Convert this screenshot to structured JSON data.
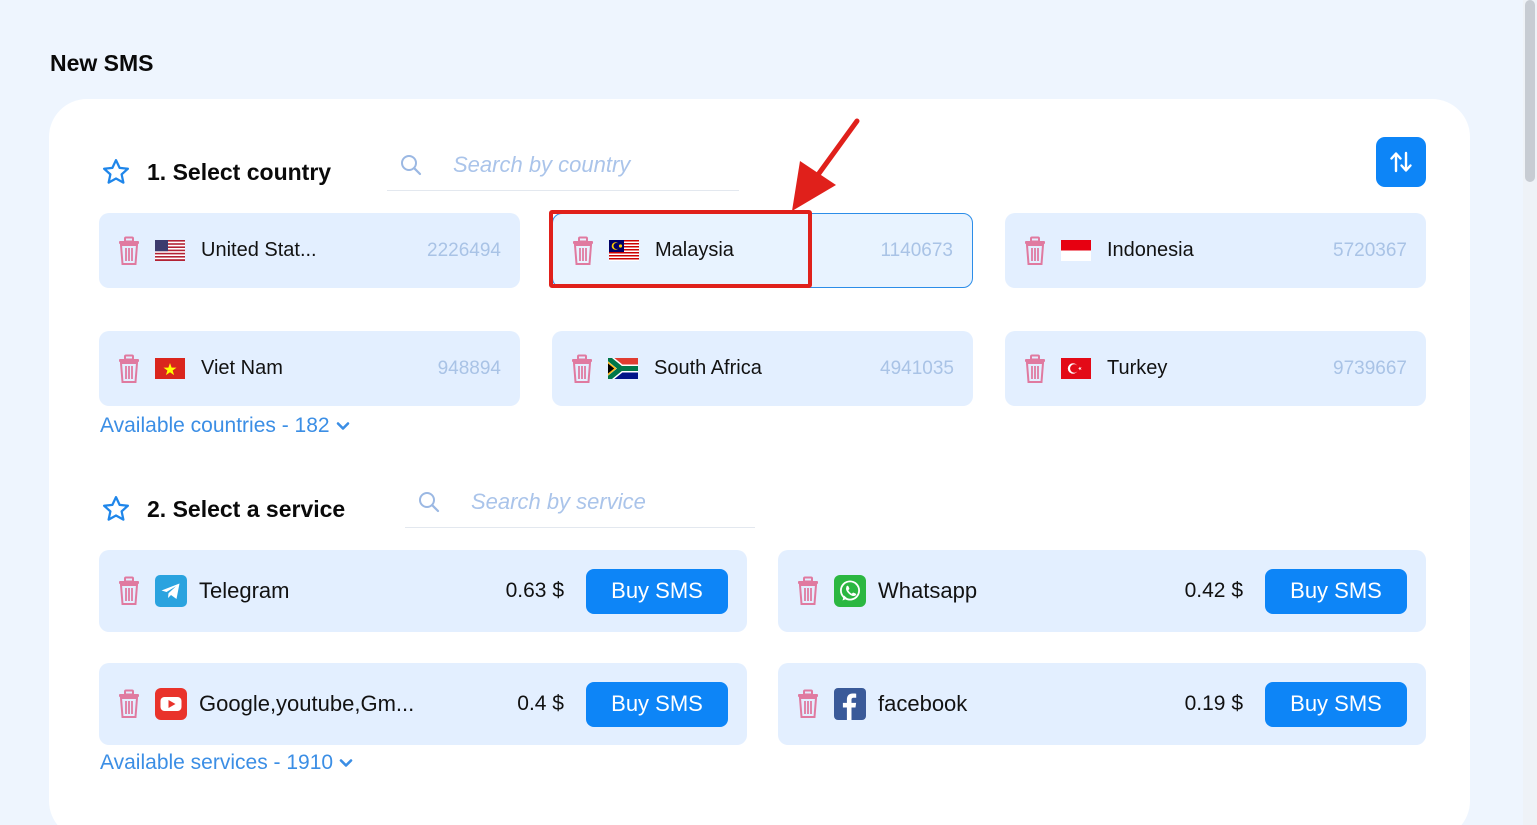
{
  "page_title": "New SMS",
  "country_section": {
    "title": "1. Select country",
    "search_placeholder": "Search by country",
    "countries": [
      {
        "name": "United Stat...",
        "count": "2226494",
        "flag": "us-flag",
        "selected": false
      },
      {
        "name": "Malaysia",
        "count": "1140673",
        "flag": "malaysia-flag",
        "selected": true
      },
      {
        "name": "Indonesia",
        "count": "5720367",
        "flag": "indonesia-flag",
        "selected": false
      },
      {
        "name": "Viet Nam",
        "count": "948894",
        "flag": "vietnam-flag",
        "selected": false
      },
      {
        "name": "South Africa",
        "count": "4941035",
        "flag": "south-africa-flag",
        "selected": false
      },
      {
        "name": "Turkey",
        "count": "9739667",
        "flag": "turkey-flag",
        "selected": false
      }
    ],
    "more_link": "Available countries - 182"
  },
  "service_section": {
    "title": "2. Select a service",
    "search_placeholder": "Search by service",
    "services": [
      {
        "name": "Telegram",
        "price": "0.63 $",
        "button": "Buy SMS",
        "icon": "telegram-icon"
      },
      {
        "name": "Whatsapp",
        "price": "0.42 $",
        "button": "Buy SMS",
        "icon": "whatsapp-icon"
      },
      {
        "name": "Google,youtube,Gm...",
        "price": "0.4 $",
        "button": "Buy SMS",
        "icon": "youtube-icon"
      },
      {
        "name": "facebook",
        "price": "0.19 $",
        "button": "Buy SMS",
        "icon": "facebook-icon"
      }
    ],
    "more_link": "Available services - 1910"
  },
  "colors": {
    "accent": "#0d85f7",
    "card_bg": "#e3efff",
    "trash": "#e07aa0",
    "annotation": "#e0201b"
  }
}
